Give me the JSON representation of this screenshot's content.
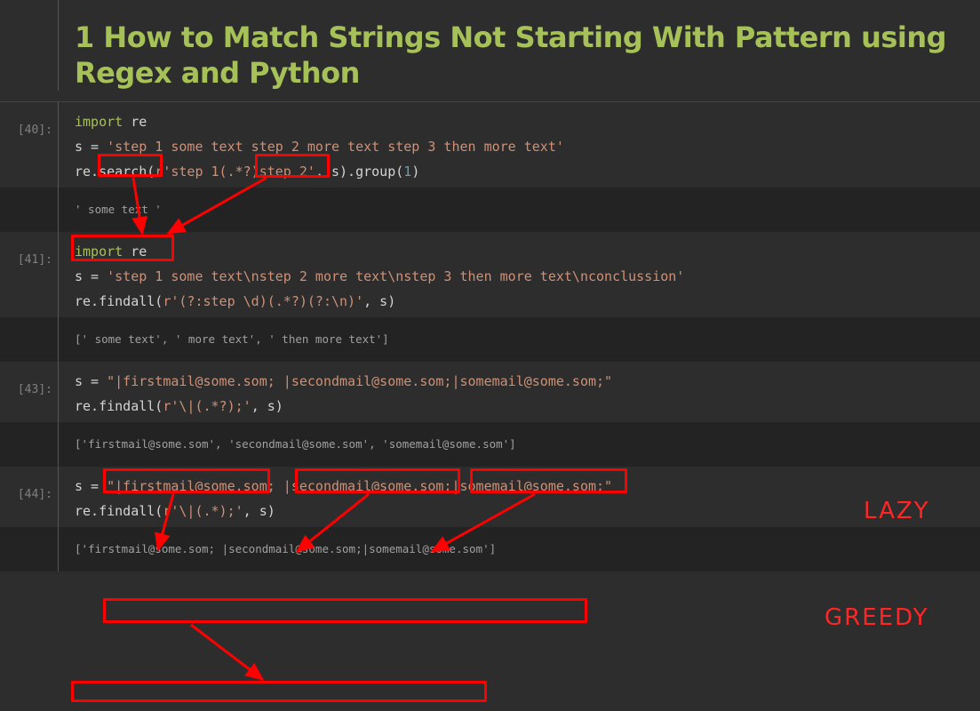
{
  "heading": "1  How to Match Strings Not Starting With Pattern using Regex and Python",
  "cells": {
    "c40": {
      "prompt": "[40]:",
      "l1_import": "import",
      "l1_mod": " re",
      "l2_pre": "s = ",
      "l2_str": "'step 1 some text step 2 more text step 3 then more text'",
      "l3_a": "re.search(",
      "l3_str": "r'step 1(.*?)step 2'",
      "l3_b": ", s).group(",
      "l3_num": "1",
      "l3_c": ")",
      "out": "' some text '"
    },
    "c41": {
      "prompt": "[41]:",
      "l1_import": "import",
      "l1_mod": " re",
      "l2_pre": "s = ",
      "l2_str": "'step 1 some text\\nstep 2 more text\\nstep 3 then more text\\nconclussion'",
      "l3_a": "re.findall(",
      "l3_str": "r'(?:step \\d)(.*?)(?:\\n)'",
      "l3_b": ", s)",
      "out": "[' some text', ' more text', ' then more text']"
    },
    "c43": {
      "prompt": "[43]:",
      "l1_pre": "s = ",
      "l1_str": "\"|firstmail@some.som; |secondmail@some.som;|somemail@some.som;\"",
      "l2_a": "re.findall(",
      "l2_str": "r'\\|(.*?);'",
      "l2_b": ", s)",
      "out": "['firstmail@some.som', 'secondmail@some.som', 'somemail@some.som']"
    },
    "c44": {
      "prompt": "[44]:",
      "l1_pre": "s = ",
      "l1_str": "\"|firstmail@some.som; |secondmail@some.som;|somemail@some.som;\"",
      "l2_a": "re.findall(",
      "l2_str": "r'\\|(.*);'",
      "l2_b": ", s)",
      "out": "['firstmail@some.som; |secondmail@some.som;|somemail@some.som']"
    }
  },
  "labels": {
    "lazy": "LAZY",
    "greedy": "GREEDY"
  }
}
